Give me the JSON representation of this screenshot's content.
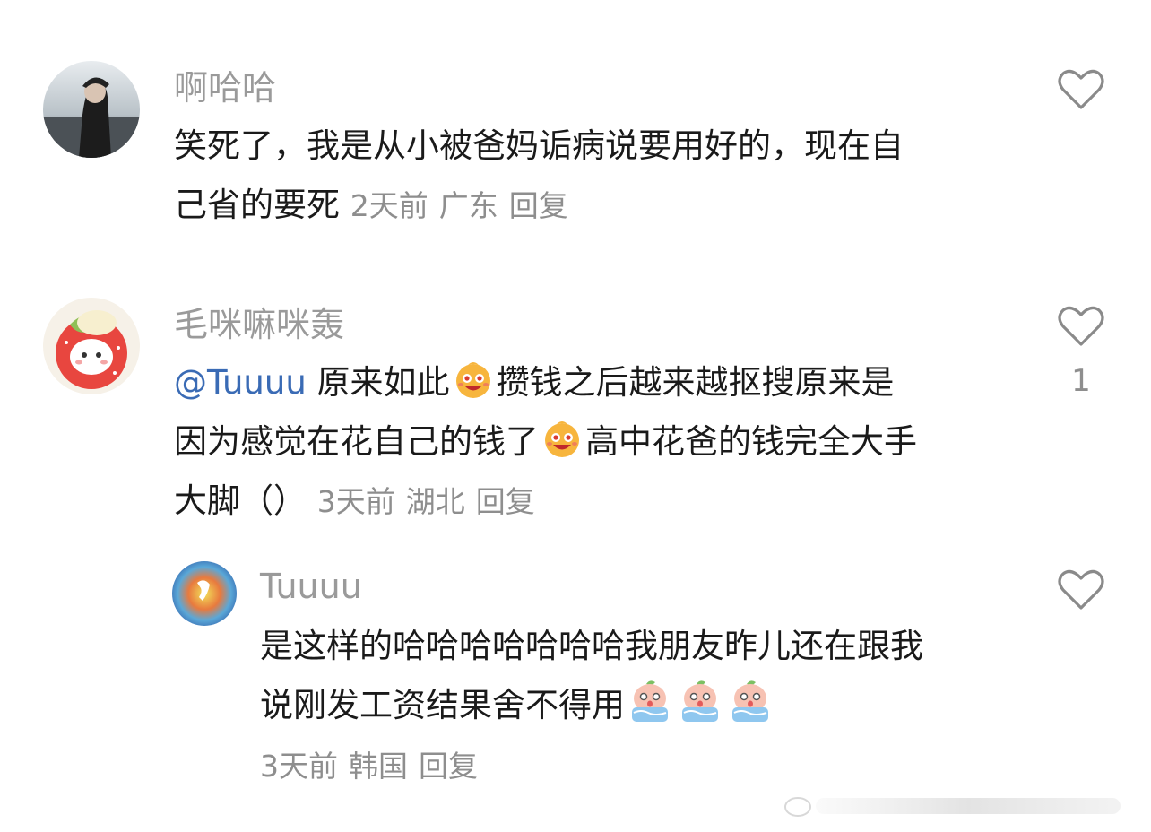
{
  "comments": [
    {
      "username": "啊哈哈",
      "line1": "笑死了，我是从小被爸妈诟病说要用好的，现在自",
      "line2": "己省的要死",
      "time": "2天前",
      "location": "广东",
      "reply": "回复"
    },
    {
      "username": "毛咪嘛咪轰",
      "mention": "@Tuuuu",
      "seg1": " 原来如此",
      "seg2": "攒钱之后越来越抠搜原来是",
      "seg3": "因为感觉在花自己的钱了",
      "seg4": "高中花爸的钱完全大手",
      "seg5": "大脚（）",
      "time": "3天前",
      "location": "湖北",
      "reply": "回复",
      "likes": "1"
    },
    {
      "username": "Tuuuu",
      "line1": "是这样的哈哈哈哈哈哈哈我朋友昨儿还在跟我",
      "line2": "说刚发工资结果舍不得用",
      "time": "3天前",
      "location": "韩国",
      "reply": "回复"
    }
  ],
  "icons": {
    "like": "heart-outline-icon",
    "emoji_grin": "grinning-face-emoji",
    "emoji_cry": "crying-peach-emoji"
  },
  "colors": {
    "mention": "#3a6bb5",
    "username": "#9a9a9a",
    "meta": "#8e8e8e"
  }
}
